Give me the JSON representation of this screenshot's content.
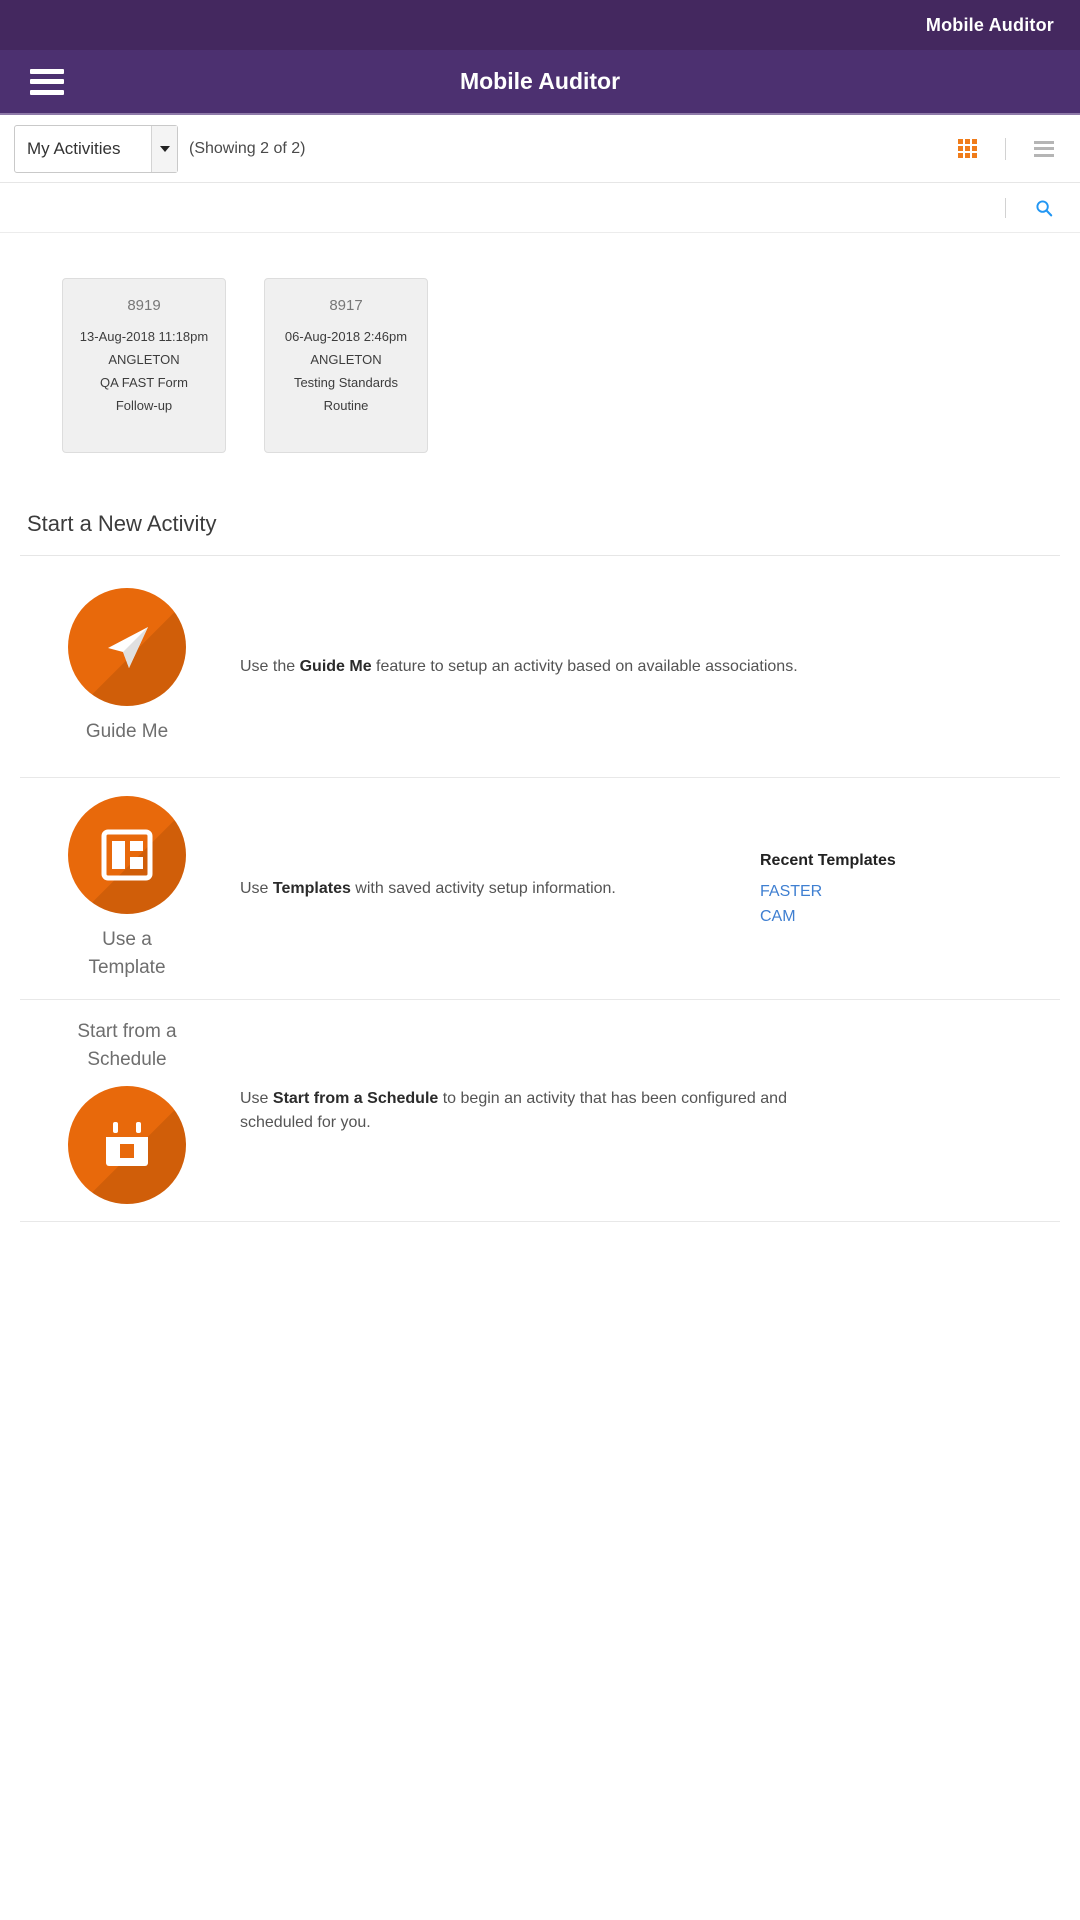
{
  "topbar": {
    "title": "Mobile Auditor"
  },
  "appbar": {
    "title": "Mobile Auditor",
    "menu_icon": "hamburger-menu-icon"
  },
  "toolbar": {
    "filter_value": "My Activities",
    "filter_options": [
      "My Activities"
    ],
    "showing_text": "(Showing 2 of 2)",
    "grid_view_icon": "grid-view-icon",
    "list_view_icon": "list-view-icon",
    "grid_active_color": "#f07c1a",
    "list_inactive_color": "#b5b5b5"
  },
  "search": {
    "icon": "search-icon",
    "icon_color": "#2196f3"
  },
  "activities": [
    {
      "id": "8919",
      "datetime": "13-Aug-2018 11:18pm",
      "location": "ANGLETON",
      "form": "QA FAST Form",
      "type": "Follow-up"
    },
    {
      "id": "8917",
      "datetime": "06-Aug-2018 2:46pm",
      "location": "ANGLETON",
      "form": "Testing Standards",
      "type": "Routine"
    }
  ],
  "new_activity": {
    "heading": "Start a New Activity",
    "rows": [
      {
        "label": "Guide Me",
        "icon": "paper-plane-icon",
        "desc_pre": "Use the ",
        "desc_bold": "Guide Me",
        "desc_post": " feature to setup an activity based on available associations."
      },
      {
        "label": "Use a\nTemplate",
        "label_line1": "Use a",
        "label_line2": "Template",
        "icon": "template-layout-icon",
        "desc_pre": "Use ",
        "desc_bold": "Templates",
        "desc_post": " with saved activity setup information.",
        "recent_templates_title": "Recent Templates",
        "recent_templates": [
          "FASTER",
          "CAM"
        ]
      },
      {
        "label_line1": "Start from a",
        "label_line2": "Schedule",
        "icon": "calendar-icon",
        "desc_pre": "Use ",
        "desc_bold": "Start from a Schedule",
        "desc_post": " to begin an activity that has been configured and scheduled for you."
      }
    ]
  },
  "theme": {
    "header_dark": "#44285f",
    "header_light": "#4c3070",
    "accent_orange": "#e8690b",
    "link_blue": "#3f7fd1"
  }
}
